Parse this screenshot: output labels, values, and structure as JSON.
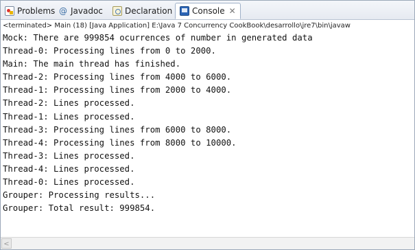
{
  "tabs": [
    {
      "label": "Problems",
      "icon": "problems-icon"
    },
    {
      "label": "Javadoc",
      "icon": "javadoc-icon"
    },
    {
      "label": "Declaration",
      "icon": "declaration-icon"
    },
    {
      "label": "Console",
      "icon": "console-icon",
      "active": true,
      "close_glyph": "✕"
    }
  ],
  "status": "<terminated> Main (18) [Java Application] E:\\Java 7 Concurrency CookBook\\desarrollo\\jre7\\bin\\javaw",
  "console_lines": [
    "Mock: There are 999854 ocurrences of number in generated data",
    "Thread-0: Processing lines from 0 to 2000.",
    "Main: The main thread has finished.",
    "Thread-2: Processing lines from 4000 to 6000.",
    "Thread-1: Processing lines from 2000 to 4000.",
    "Thread-2: Lines processed.",
    "Thread-1: Lines processed.",
    "Thread-3: Processing lines from 6000 to 8000.",
    "Thread-4: Processing lines from 8000 to 10000.",
    "Thread-3: Lines processed.",
    "Thread-4: Lines processed.",
    "Thread-0: Lines processed.",
    "Grouper: Processing results...",
    "Grouper: Total result: 999854."
  ],
  "scrollbar": {
    "left_arrow": "<"
  }
}
